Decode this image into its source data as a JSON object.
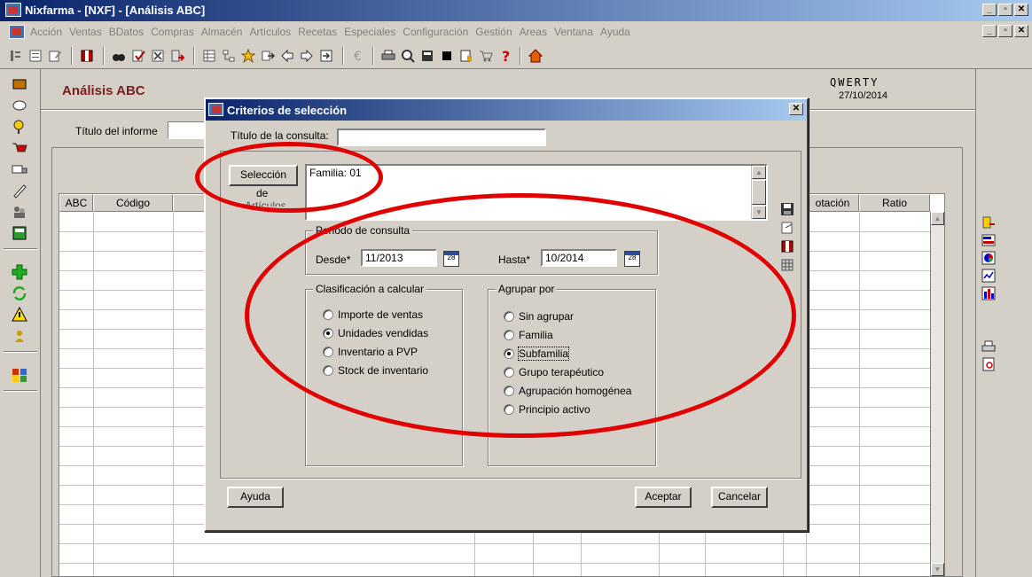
{
  "window": {
    "title": "Nixfarma - [NXF] - [Análisis ABC]",
    "controls": [
      "_",
      "▫",
      "✕"
    ]
  },
  "menu": {
    "items": [
      "Acción",
      "Ventas",
      "BDatos",
      "Compras",
      "Almacén",
      "Artículos",
      "Recetas",
      "Especiales",
      "Configuración",
      "Gestión",
      "Areas",
      "Ventana",
      "Ayuda"
    ]
  },
  "main": {
    "title": "Análisis ABC",
    "company": "QWERTY",
    "date": "27/10/2014",
    "report_title_label": "Título del informe",
    "table_headers": {
      "abc": "ABC",
      "codigo": "Código",
      "rotacion": "otación",
      "ratio": "Ratio"
    }
  },
  "dialog": {
    "title": "Criterios de selección",
    "close": "✕",
    "consulta_label": "Título de la consulta:",
    "consulta_value": "",
    "seleccion_button_line1": "Selección",
    "seleccion_button_line2": "de",
    "seleccion_button_line3": "Artículos",
    "selection_text": "Familia: 01",
    "periodo": {
      "label": "Periodo de consulta",
      "desde_label": "Desde*",
      "desde_value": "11/2013",
      "hasta_label": "Hasta*",
      "hasta_value": "10/2014"
    },
    "clasificacion": {
      "label": "Clasificación a calcular",
      "options": [
        "Importe de ventas",
        "Unidades vendidas",
        "Inventario a PVP",
        "Stock de inventario"
      ],
      "selected_index": 1
    },
    "agrupar": {
      "label": "Agrupar por",
      "options": [
        "Sin agrupar",
        "Familia",
        "Subfamilia",
        "Grupo terapéutico",
        "Agrupación homogénea",
        "Principio activo"
      ],
      "selected_index": 2
    },
    "buttons": {
      "ayuda": "Ayuda",
      "aceptar": "Aceptar",
      "cancelar": "Cancelar"
    }
  },
  "colors": {
    "accent_red": "#e00000",
    "title_blue": "#0a246a",
    "heading_maroon": "#7a1f1f"
  }
}
